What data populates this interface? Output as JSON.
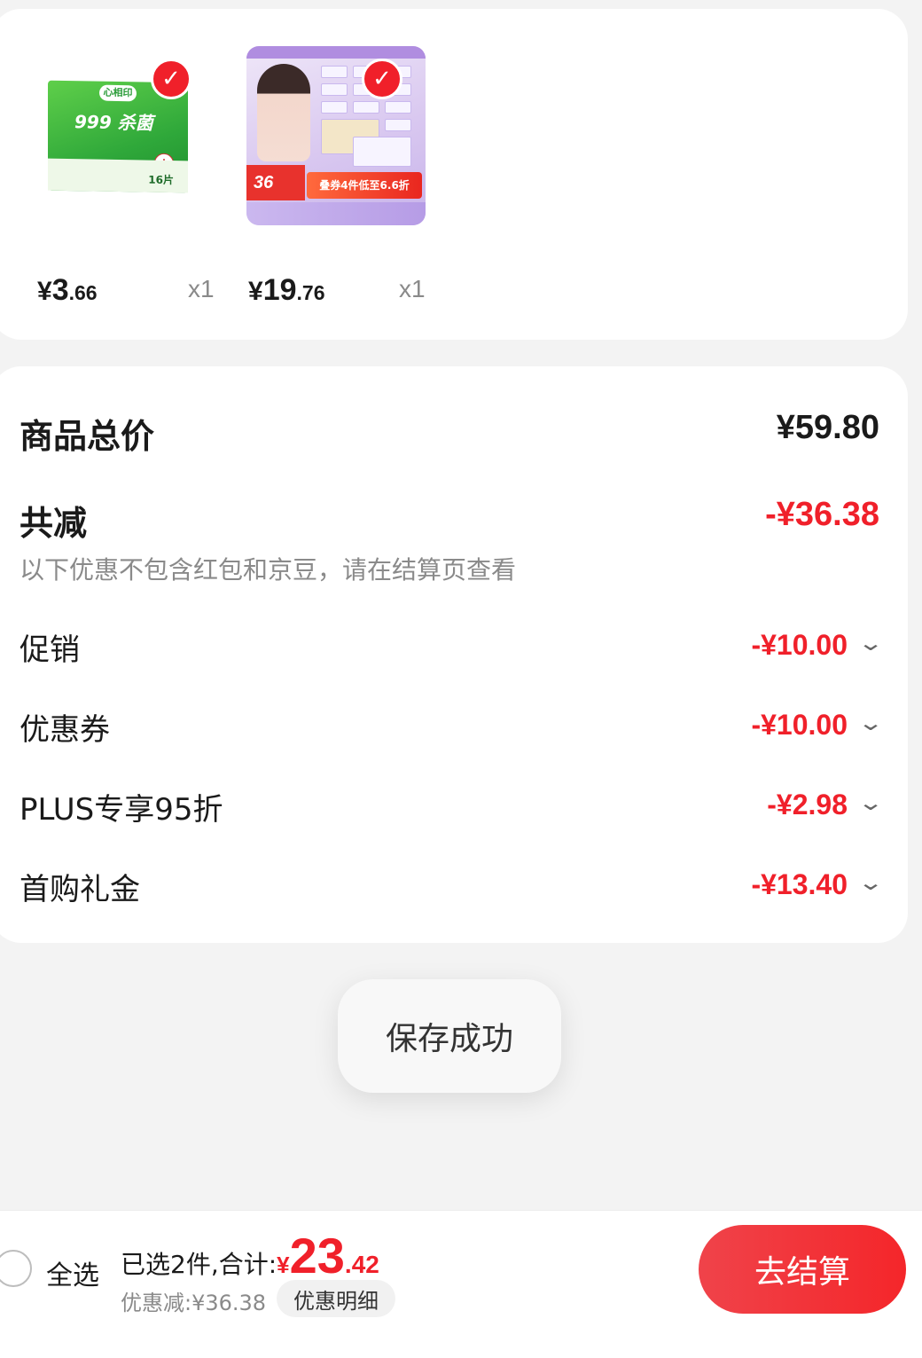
{
  "products": [
    {
      "image_label": "999 杀菌 卫生湿巾 16片",
      "price_currency": "¥",
      "price_integer": "3",
      "price_decimal": ".66",
      "quantity": "x1",
      "selected": true
    },
    {
      "image_label": "叠券4件低至6.6折",
      "price_currency": "¥",
      "price_integer": "19",
      "price_decimal": ".76",
      "quantity": "x1",
      "selected": true
    }
  ],
  "summary": {
    "total_label": "商品总价",
    "total_value": "¥59.80",
    "reduce_label": "共减",
    "reduce_value": "-¥36.38",
    "note": "以下优惠不包含红包和京豆，请在结算页查看",
    "discounts": [
      {
        "label": "促销",
        "value": "-¥10.00"
      },
      {
        "label": "优惠券",
        "value": "-¥10.00"
      },
      {
        "label": "PLUS专享95折",
        "value": "-¥2.98"
      },
      {
        "label": "首购礼金",
        "value": "-¥13.40"
      }
    ]
  },
  "toast": {
    "text": "保存成功"
  },
  "bottom_bar": {
    "select_all_label": "全选",
    "sum_prefix": "已选2件,合计:",
    "sum_currency": "¥",
    "sum_integer": "23",
    "sum_decimal": ".42",
    "saved_text": "优惠减:¥36.38",
    "detail_label": "优惠明细",
    "checkout_label": "去结算"
  },
  "icons": {
    "check": "check-icon",
    "chevron": "chevron-down-icon"
  },
  "colors": {
    "accent": "#f0202a",
    "background": "#f3f3f3",
    "card": "#ffffff"
  }
}
